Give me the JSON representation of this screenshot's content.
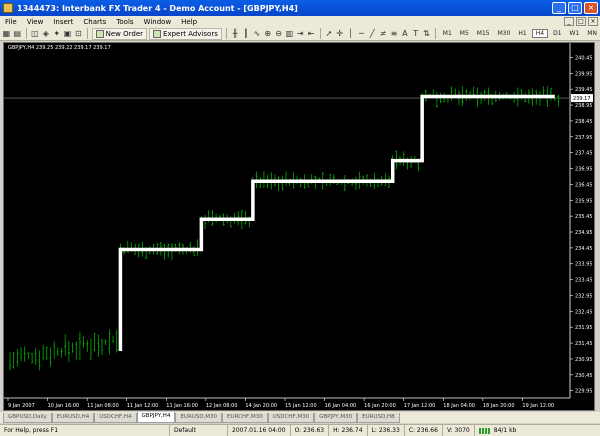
{
  "window": {
    "title": "1344473: Interbank FX Trader 4 - Demo Account - [GBPJPY,H4]",
    "minimize": "_",
    "maximize": "□",
    "close": "×"
  },
  "menu": [
    "File",
    "View",
    "Insert",
    "Charts",
    "Tools",
    "Window",
    "Help"
  ],
  "toolbar": {
    "new_order": "New Order",
    "expert_advisors": "Expert Advisors",
    "timeframes": [
      "M1",
      "M5",
      "M15",
      "M30",
      "H1",
      "H4",
      "D1",
      "W1",
      "MN"
    ],
    "active_timeframe": "H4"
  },
  "chart": {
    "info": "GBPJPY,H4 239.25 239.22 239.17 239.17",
    "price_label": "239.17",
    "colors": {
      "background": "#000000",
      "bars": "#00c800",
      "overlay": "#ffffff",
      "text": "#ffffff"
    }
  },
  "chart_data": {
    "type": "bar",
    "symbol": "GBPJPY",
    "timeframe": "H4",
    "y_ticks": [
      "240.45",
      "239.95",
      "239.45",
      "238.95",
      "238.45",
      "237.95",
      "237.45",
      "236.95",
      "236.45",
      "235.95",
      "235.45",
      "234.95",
      "234.45",
      "233.95",
      "233.45",
      "232.95",
      "232.45",
      "231.95",
      "231.45",
      "230.95",
      "230.45",
      "229.95"
    ],
    "ylim": [
      229.72,
      240.59
    ],
    "current_price": 239.17,
    "x_ticks": [
      "9 Jan 2007",
      "10 Jan 16:00",
      "11 Jan 08:00",
      "11 Jan 12:00",
      "11 Jan 16:00",
      "12 Jan 08:00",
      "14 Jan 20:00",
      "15 Jan 12:00",
      "16 Jan 04:00",
      "16 Jan 20:00",
      "17 Jan 12:00",
      "18 Jan 04:00",
      "18 Jan 20:00",
      "19 Jan 12:00"
    ],
    "step_overlay": [
      {
        "bar": 30,
        "price": 231.2
      },
      {
        "bar": 30,
        "price": 234.4
      },
      {
        "bar": 52,
        "price": 234.4
      },
      {
        "bar": 52,
        "price": 235.35
      },
      {
        "bar": 66,
        "price": 235.35
      },
      {
        "bar": 66,
        "price": 236.55
      },
      {
        "bar": 104,
        "price": 236.55
      },
      {
        "bar": 104,
        "price": 237.2
      },
      {
        "bar": 112,
        "price": 237.2
      },
      {
        "bar": 112,
        "price": 239.22
      },
      {
        "bar": 148,
        "price": 239.22
      }
    ]
  },
  "tabs": [
    "GBPUSD,Daily",
    "EURUSD,H4",
    "USDCHF,H4",
    "GBPJPY,H4",
    "EURUSD,M30",
    "EURCHF,M30",
    "USDCHF,M30",
    "GBPJPY,M30",
    "EURUSD,H8"
  ],
  "active_tab": "GBPJPY,H4",
  "status": {
    "help": "For Help, press F1",
    "profile": "Default",
    "datetime": "2007.01.16 04:00",
    "open": "O: 236.63",
    "high": "H: 236.74",
    "low": "L: 236.33",
    "close": "C: 236.66",
    "volume": "V: 3070",
    "traffic": "84/1 kb"
  }
}
